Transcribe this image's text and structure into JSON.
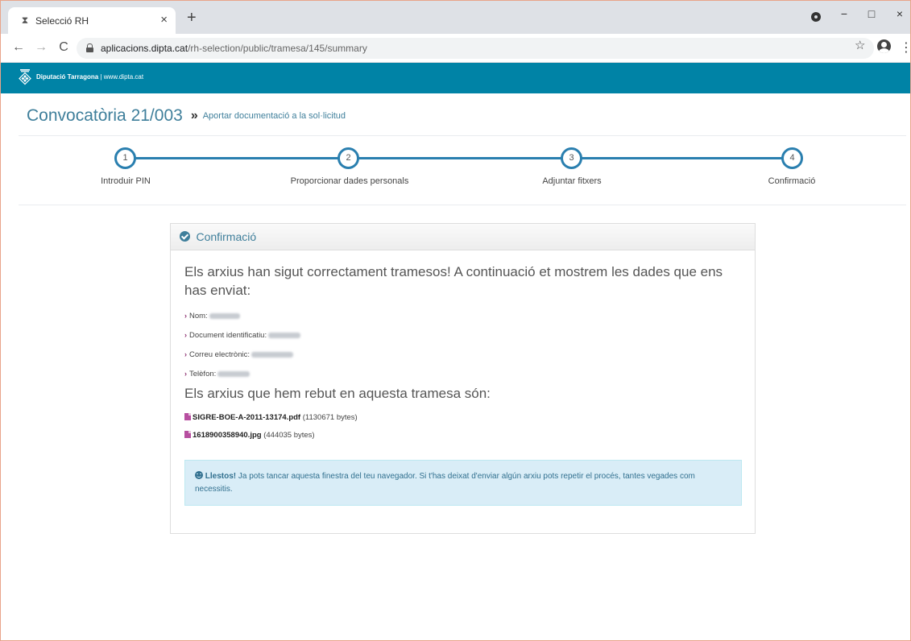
{
  "browser": {
    "tab_title": "Selecció RH",
    "tab_favicon": "hourglass-icon",
    "tab_close": "×",
    "new_tab": "+",
    "window_controls": {
      "minimize": "−",
      "maximize": "□",
      "close": "×"
    },
    "url_host": "aplicacions.dipta.cat",
    "url_path": "/rh-selection/public/tramesa/145/summary",
    "nav": {
      "back": "←",
      "forward": "→",
      "reload": "C"
    },
    "star": "☆",
    "menu": "⋮"
  },
  "site_header": {
    "org_name": "Diputació Tarragona",
    "separator": " | ",
    "website": "www.dipta.cat",
    "background_color": "#0083a6"
  },
  "page": {
    "title": "Convocatòria 21/003",
    "title_separator": "»",
    "subtitle": "Aportar documentació a la sol·licitud"
  },
  "stepper": {
    "steps": [
      {
        "number": "1",
        "label": "Introduir PIN"
      },
      {
        "number": "2",
        "label": "Proporcionar dades personals"
      },
      {
        "number": "3",
        "label": "Adjuntar fitxers"
      },
      {
        "number": "4",
        "label": "Confirmació"
      }
    ],
    "color": "#2a7faf"
  },
  "card": {
    "title": "Confirmació",
    "lead": "Els arxius han sigut correctament tramesos! A continuació et mostrem les dades que ens has enviat:",
    "fields": [
      {
        "label": "Nom:"
      },
      {
        "label": "Document identificatiu:"
      },
      {
        "label": "Correu electrònic:"
      },
      {
        "label": "Telèfon:"
      }
    ],
    "files_heading": "Els arxius que hem rebut en aquesta tramesa són:",
    "files": [
      {
        "name": "SIGRE-BOE-A-2011-13174.pdf",
        "size": "(1130671 bytes)"
      },
      {
        "name": "1618900358940.jpg",
        "size": "(444035 bytes)"
      }
    ],
    "alert_strong": "Llestos!",
    "alert_text": " Ja pots tancar aquesta finestra del teu navegador. Si t'has deixat d'enviar algún arxiu pots repetir el procés, tantes vegades com necessitis."
  }
}
